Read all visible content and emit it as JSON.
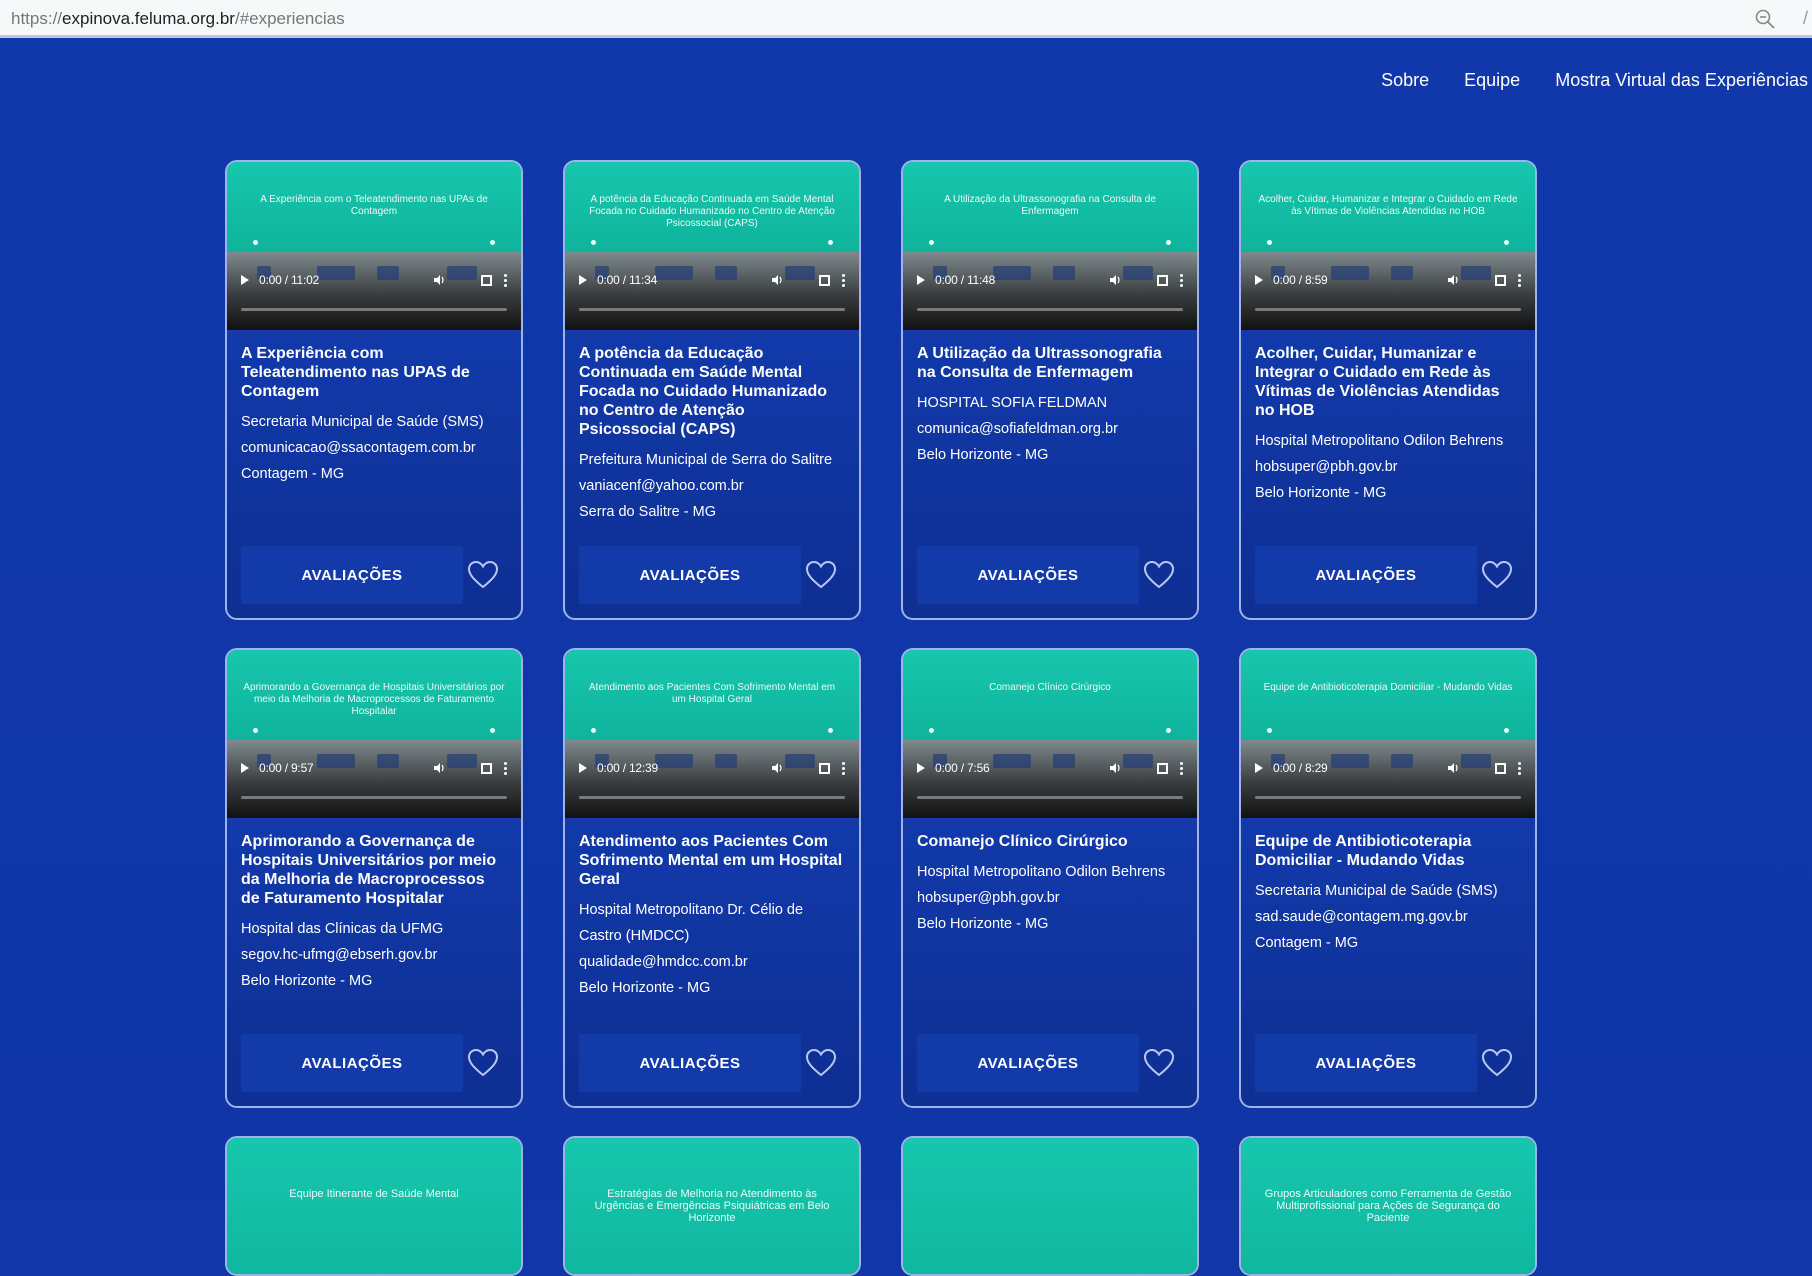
{
  "browser": {
    "url_prefix": "https://",
    "url_host": "expinova.feluma.org.br",
    "url_path": "/#experiencias"
  },
  "nav": {
    "items": [
      "Sobre",
      "Equipe",
      "Mostra Virtual das Experiências"
    ]
  },
  "button_label": "AVALIAÇÕES",
  "cards": [
    {
      "slide_title": "A Experiência com o Teleatendimento nas UPAs de Contagem",
      "time": "0:00 / 11:02",
      "title": "A Experiência com Teleatendimento nas UPAS de Contagem",
      "org": "Secretaria Municipal de Saúde (SMS)",
      "email": "comunicacao@ssacontagem.com.br",
      "city": "Contagem - MG"
    },
    {
      "slide_title": "A potência da Educação Continuada em Saúde Mental Focada no Cuidado Humanizado no Centro de Atenção Psicossocial (CAPS)",
      "time": "0:00 / 11:34",
      "title": "A potência da Educação Continuada em Saúde Mental Focada no Cuidado Humanizado no Centro de Atenção Psicossocial (CAPS)",
      "org": "Prefeitura Municipal de Serra do Salitre",
      "email": "vaniacenf@yahoo.com.br",
      "city": "Serra do Salitre - MG"
    },
    {
      "slide_title": "A Utilização da Ultrassonografia na Consulta de Enfermagem",
      "time": "0:00 / 11:48",
      "title": "A Utilização da Ultrassonografia na Consulta de Enfermagem",
      "org": "HOSPITAL SOFIA FELDMAN",
      "email": "comunica@sofiafeldman.org.br",
      "city": "Belo Horizonte - MG"
    },
    {
      "slide_title": "Acolher, Cuidar, Humanizar e Integrar o Cuidado em Rede às Vítimas de Violências Atendidas no HOB",
      "time": "0:00 / 8:59",
      "title": "Acolher, Cuidar, Humanizar e Integrar o Cuidado em Rede às Vítimas de Violências Atendidas no HOB",
      "org": "Hospital Metropolitano Odilon Behrens",
      "email": "hobsuper@pbh.gov.br",
      "city": "Belo Horizonte - MG"
    },
    {
      "slide_title": "Aprimorando a Governança de Hospitais Universitários por meio da Melhoria de Macroprocessos de Faturamento Hospitalar",
      "time": "0:00 / 9:57",
      "title": "Aprimorando a Governança de Hospitais Universitários por meio da Melhoria de Macroprocessos de Faturamento Hospitalar",
      "org": "Hospital das Clínicas da UFMG",
      "email": "segov.hc-ufmg@ebserh.gov.br",
      "city": "Belo Horizonte - MG"
    },
    {
      "slide_title": "Atendimento aos Pacientes Com Sofrimento Mental em um Hospital Geral",
      "time": "0:00 / 12:39",
      "title": "Atendimento aos Pacientes Com Sofrimento Mental em um Hospital Geral",
      "org": "Hospital Metropolitano Dr. Célio de Castro (HMDCC)",
      "email": "qualidade@hmdcc.com.br",
      "city": "Belo Horizonte - MG"
    },
    {
      "slide_title": "Comanejo Clínico Cirúrgico",
      "time": "0:00 / 7:56",
      "title": "Comanejo Clínico Cirúrgico",
      "org": "Hospital Metropolitano Odilon Behrens",
      "email": "hobsuper@pbh.gov.br",
      "city": "Belo Horizonte - MG"
    },
    {
      "slide_title": "Equipe de Antibioticoterapia Domiciliar - Mudando Vidas",
      "time": "0:00 / 8:29",
      "title": "Equipe de Antibioticoterapia Domiciliar - Mudando Vidas",
      "org": "Secretaria Municipal de Saúde (SMS)",
      "email": "sad.saude@contagem.mg.gov.br",
      "city": "Contagem - MG"
    }
  ],
  "partial_cards": [
    {
      "slide_title": "Equipe Itinerante de Saúde Mental"
    },
    {
      "slide_title": "Estratégias de Melhoria no Atendimento às Urgências e Emergências Psiquiátricas em Belo Horizonte"
    },
    {
      "slide_title": ""
    },
    {
      "slide_title": "Grupos Articuladores como Ferramenta de Gestão Multiprofissional para Ações de Segurança do Paciente"
    }
  ]
}
